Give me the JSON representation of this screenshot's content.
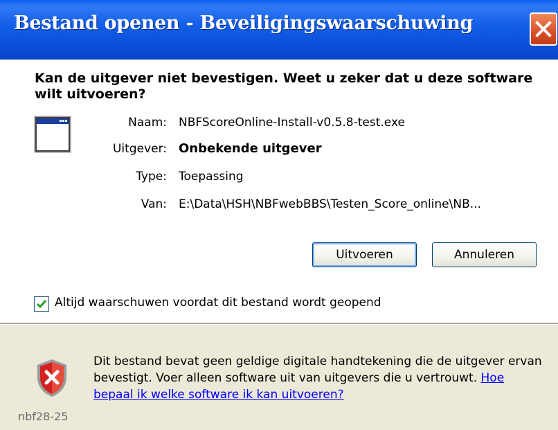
{
  "window": {
    "title": "Bestand openen - Beveiligingswaarschuwing"
  },
  "heading": "Kan de uitgever niet bevestigen. Weet u zeker dat u deze software wilt uitvoeren?",
  "fields": {
    "name_label": "Naam:",
    "name_value": "NBFScoreOnline-Install-v0.5.8-test.exe",
    "publisher_label": "Uitgever:",
    "publisher_value": "Onbekende uitgever",
    "type_label": "Type:",
    "type_value": "Toepassing",
    "from_label": "Van:",
    "from_value": "E:\\Data\\HSH\\NBFwebBBS\\Testen_Score_online\\NB..."
  },
  "buttons": {
    "run": "Uitvoeren",
    "cancel": "Annuleren"
  },
  "checkbox": {
    "label": "Altijd waarschuwen voordat dit bestand wordt geopend",
    "checked": true
  },
  "info": {
    "text": "Dit bestand bevat geen geldige digitale handtekening die de uitgever ervan bevestigt. Voer alleen software uit van uitgevers die u vertrouwt. ",
    "link": "Hoe bepaal ik welke software ik kan uitvoeren?"
  },
  "stamp": "nbf28-25",
  "icons": {
    "app": "application-window-icon",
    "shield": "security-shield-x-icon",
    "close": "close-icon",
    "check": "checkmark-icon"
  },
  "colors": {
    "titlebar": "#0a54e3",
    "close": "#d8502a",
    "link": "#0000ff",
    "shield": "#d32020"
  }
}
